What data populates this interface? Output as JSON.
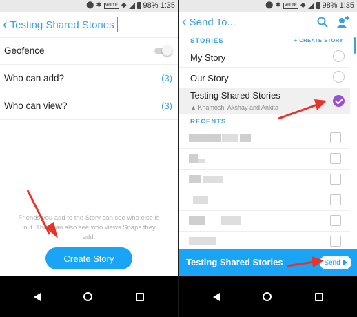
{
  "status_bar": {
    "battery": "98%",
    "time": "1:35",
    "volte": "VoLTE"
  },
  "left": {
    "back_label": "‹",
    "title": "Testing Shared Stories",
    "settings": [
      {
        "label": "Geofence",
        "value": ""
      },
      {
        "label": "Who can add?",
        "value": "(3)"
      },
      {
        "label": "Who can view?",
        "value": "(3)"
      }
    ],
    "info_text": "Friends you add to the Story can see who else is in it. They can also see who views Snaps they add.",
    "create_button": "Create Story"
  },
  "right": {
    "title": "Send To...",
    "stories_label": "STORIES",
    "create_story_link": "+ CREATE STORY",
    "stories": [
      {
        "name": "My Story",
        "checked": false
      },
      {
        "name": "Our Story",
        "checked": false
      },
      {
        "name": "Testing Shared Stories",
        "checked": true,
        "members": "Khamosh, Akshay and Ankita"
      }
    ],
    "recents_label": "RECENTS",
    "sendbar_title": "Testing Shared Stories",
    "send_button": "Send"
  },
  "colors": {
    "accent": "#3d9fe0",
    "button": "#1aa4f5",
    "check": "#9b4fd1",
    "annotation_arrow": "#e8332a"
  },
  "icons": [
    "wifi-icon",
    "bluetooth-icon",
    "signal-icon",
    "battery-icon",
    "search-icon",
    "add-friend-icon",
    "back-chevron-icon",
    "send-arrow-icon",
    "nav-back-icon",
    "nav-home-icon",
    "nav-recent-icon"
  ]
}
